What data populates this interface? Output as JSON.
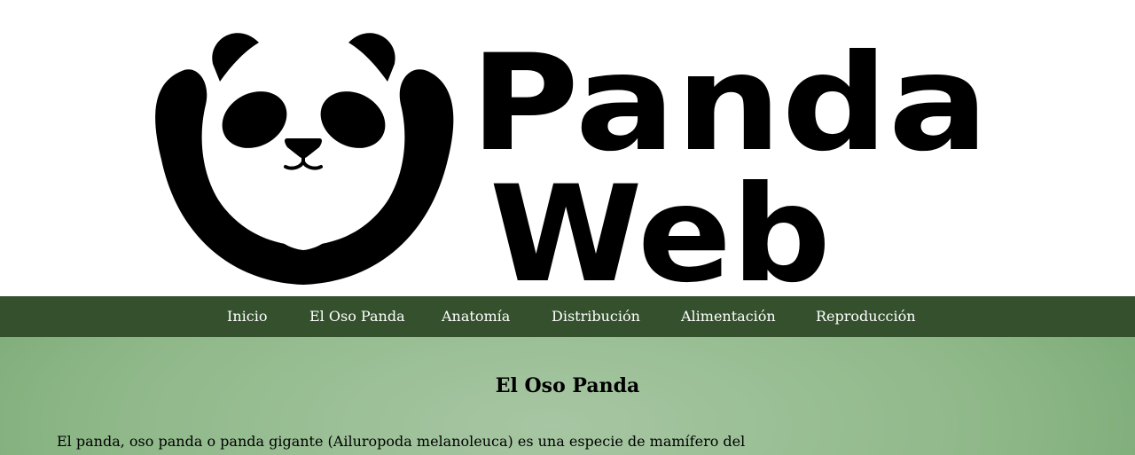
{
  "logo": {
    "word1": "Panda",
    "word2": "Web"
  },
  "nav": {
    "items": [
      {
        "label": "Inicio"
      },
      {
        "label": "El Oso Panda"
      },
      {
        "label": "Anatomía"
      },
      {
        "label": "Distribución"
      },
      {
        "label": "Alimentación"
      },
      {
        "label": "Reproducción"
      }
    ]
  },
  "main": {
    "title": "El Oso Panda",
    "paragraph": "El panda, oso panda o panda gigante (Ailuropoda melanoleuca) es una especie de mamífero del"
  },
  "colors": {
    "nav_bg": "#34502d",
    "content_bg": "#8fb889",
    "logo": "#000000"
  }
}
